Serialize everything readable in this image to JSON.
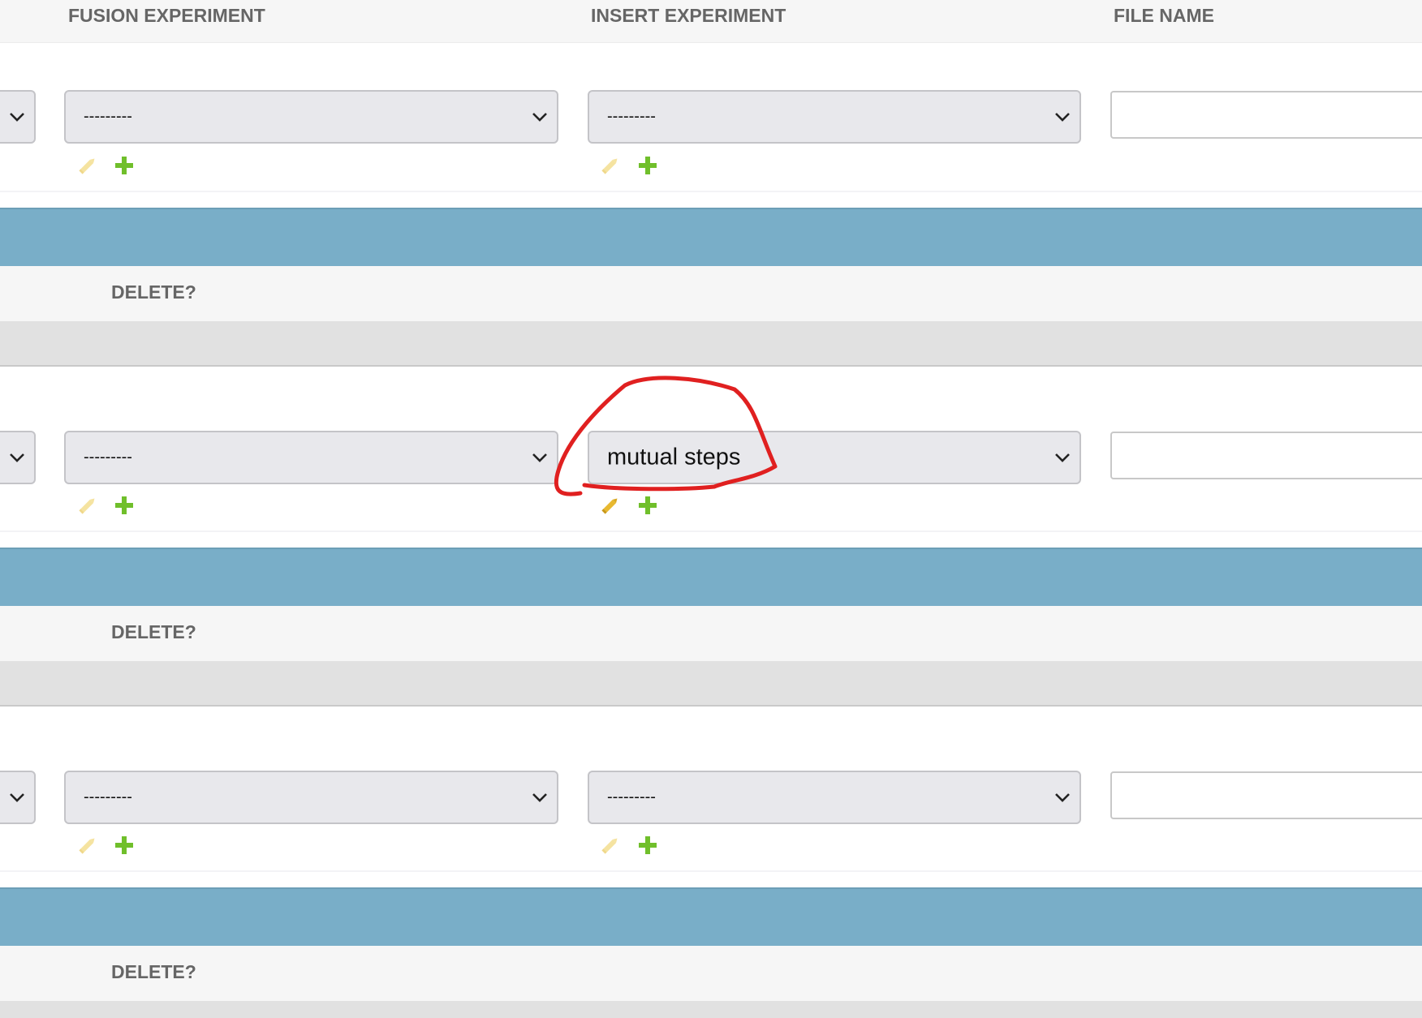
{
  "headers": {
    "fusion_experiment": "FUSION EXPERIMENT",
    "insert_experiment": "INSERT EXPERIMENT",
    "file_name": "FILE NAME"
  },
  "rows": [
    {
      "fusion_select": "---------",
      "insert_select": "---------",
      "file_name_value": "",
      "delete_label": "DELETE?"
    },
    {
      "fusion_select": "---------",
      "insert_select": "mutual steps",
      "file_name_value": "",
      "delete_label": "DELETE?"
    },
    {
      "fusion_select": "---------",
      "insert_select": "---------",
      "file_name_value": "",
      "delete_label": "DELETE?"
    }
  ],
  "icons": {
    "edit": "pencil-icon",
    "add": "plus-icon",
    "dropdown": "chevron-down-icon"
  },
  "colors": {
    "header_bg": "#f6f6f6",
    "header_text": "#666666",
    "row_separator": "#79aec8",
    "select_bg": "#e8e8ec",
    "add_icon": "#70bf2b",
    "edit_icon_disabled": "#f5e3a0",
    "edit_icon_active": "#e8b930",
    "annotation": "#e02020"
  }
}
